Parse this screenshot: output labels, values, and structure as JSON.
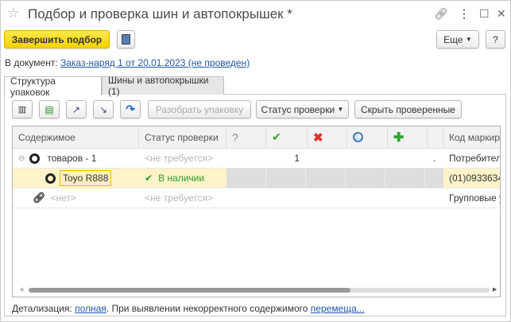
{
  "window": {
    "title": "Подбор и проверка шин и автопокрышек *"
  },
  "toolbar": {
    "finish_label": "Завершить подбор",
    "more_label": "Еще",
    "help_label": "?"
  },
  "document": {
    "label": "В документ:",
    "link": "Заказ-наряд 1 от 20.01.2023 (не проведен)"
  },
  "tabs": [
    {
      "label": "Структура упаковок"
    },
    {
      "label": "Шины и автопокрышки (1)"
    }
  ],
  "actions": {
    "unpack": "Разобрать упаковку",
    "status": "Статус проверки",
    "hide": "Скрыть проверенные"
  },
  "grid": {
    "columns": [
      "Содержимое",
      "Статус проверки",
      "?",
      "Код маркиро"
    ],
    "rows": [
      {
        "content": "товаров - 1",
        "status": "<не требуется>",
        "q": "",
        "check": "1",
        "dot": ".",
        "code": "Потребитель"
      },
      {
        "content": "Toyo R888",
        "status": "В наличии",
        "code": "(01)0933634"
      },
      {
        "content": "<нет>",
        "status": "<не требуется>",
        "code": "Групповые у"
      }
    ]
  },
  "footer": {
    "label": "Детализация:",
    "detail_link": "полная",
    "text": ". При выявлении некорректного содержимого ",
    "move_link": "перемеща..."
  },
  "colors": {
    "accent": "#f5d300",
    "link": "#2158a6",
    "selected_row": "#fdf3c8",
    "ok": "#2ea52e",
    "error": "#e0302a"
  }
}
